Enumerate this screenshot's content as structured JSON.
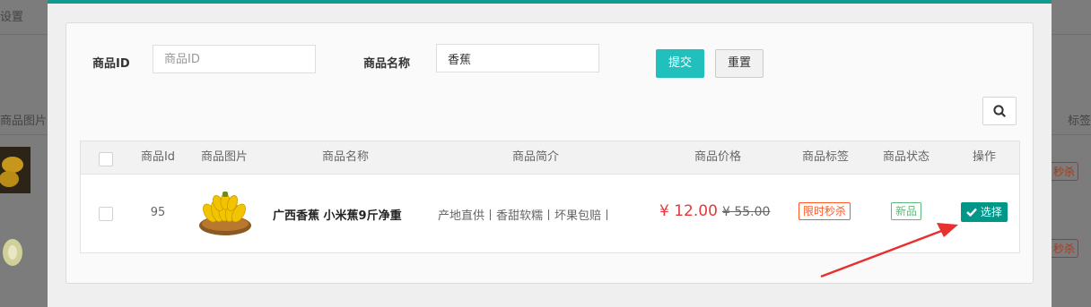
{
  "background": {
    "tab_label": "设置",
    "col_image": "商品图片",
    "col_tag": "标签",
    "badge": "秒杀"
  },
  "form": {
    "id_label": "商品ID",
    "id_placeholder": "商品ID",
    "id_value": "",
    "name_label": "商品名称",
    "name_value": "香蕉",
    "submit_label": "提交",
    "reset_label": "重置"
  },
  "table": {
    "headers": [
      "商品Id",
      "商品图片",
      "商品名称",
      "商品简介",
      "商品价格",
      "商品标签",
      "商品状态",
      "操作"
    ],
    "rows": [
      {
        "id": "95",
        "name": "广西香蕉 小米蕉9斤净重",
        "summary": "产地直供丨香甜软糯丨坏果包赔丨",
        "price": "¥ 12.00",
        "original_price": "¥ 55.00",
        "tag": "限时秒杀",
        "status": "新品",
        "action_label": "选择"
      }
    ]
  },
  "colors": {
    "accent": "#0f9a8f",
    "submit": "#21c0bd",
    "select": "#009688",
    "price": "#e4393c",
    "flash_tag": "#ff5722",
    "new_tag": "#5fb878",
    "arrow": "#e8302f"
  },
  "icons": {
    "search": "search-icon",
    "select": "check-icon"
  }
}
